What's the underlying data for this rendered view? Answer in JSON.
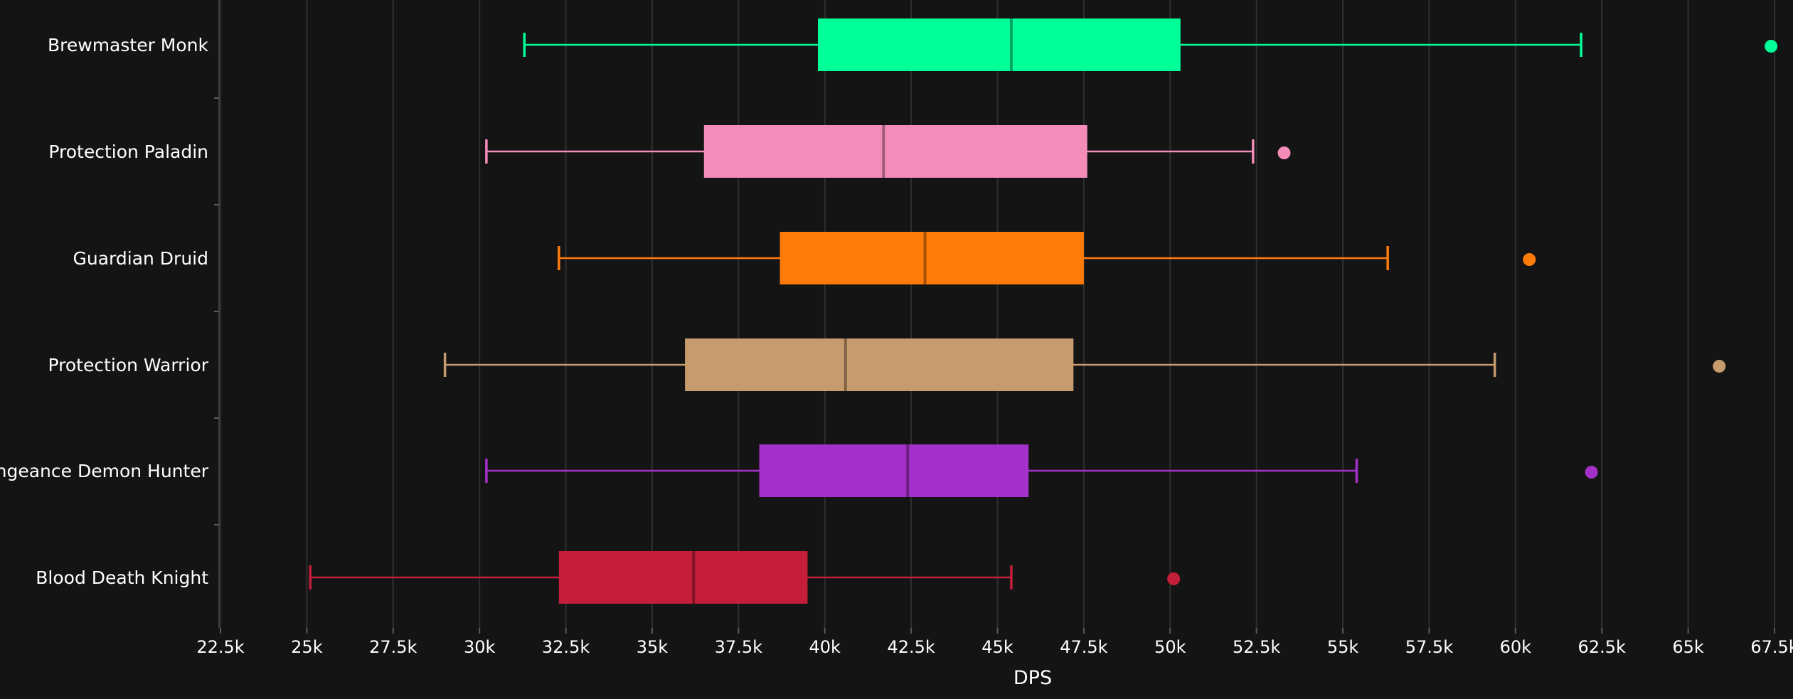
{
  "chart_data": {
    "type": "boxplot",
    "orientation": "horizontal",
    "xlabel": "DPS",
    "xlim": [
      22500,
      67500
    ],
    "x_ticks": [
      22500,
      25000,
      27500,
      30000,
      32500,
      35000,
      37500,
      40000,
      42500,
      45000,
      47500,
      50000,
      52500,
      55000,
      57500,
      60000,
      62500,
      65000,
      67500
    ],
    "x_tick_labels": [
      "22.5k",
      "25k",
      "27.5k",
      "30k",
      "32.5k",
      "35k",
      "37.5k",
      "40k",
      "42.5k",
      "45k",
      "47.5k",
      "50k",
      "52.5k",
      "55k",
      "57.5k",
      "60k",
      "62.5k",
      "65k",
      "67.5k"
    ],
    "grid": "vertical",
    "background_color": "#141414",
    "categories": [
      {
        "label": "Brewmaster Monk",
        "color": "#00ff98",
        "whisker_low": 31300,
        "q1": 39800,
        "median": 45400,
        "q3": 50300,
        "whisker_high": 61900,
        "outliers": [
          67400
        ]
      },
      {
        "label": "Protection Paladin",
        "color": "#f48cba",
        "whisker_low": 30200,
        "q1": 36500,
        "median": 41700,
        "q3": 47600,
        "whisker_high": 52400,
        "outliers": [
          53300
        ]
      },
      {
        "label": "Guardian Druid",
        "color": "#ff7c0a",
        "whisker_low": 32300,
        "q1": 38700,
        "median": 42900,
        "q3": 47500,
        "whisker_high": 56300,
        "outliers": [
          60400
        ]
      },
      {
        "label": "Protection Warrior",
        "color": "#c69b6d",
        "whisker_low": 29000,
        "q1": 35950,
        "median": 40600,
        "q3": 47200,
        "whisker_high": 59400,
        "outliers": [
          65900
        ]
      },
      {
        "label": "Vengeance Demon Hunter",
        "color": "#a330c9",
        "whisker_low": 30200,
        "q1": 38100,
        "median": 42400,
        "q3": 45900,
        "whisker_high": 55400,
        "outliers": [
          62200
        ]
      },
      {
        "label": "Blood Death Knight",
        "color": "#c41e3a",
        "whisker_low": 25100,
        "q1": 32300,
        "median": 36200,
        "q3": 39500,
        "whisker_high": 45400,
        "outliers": [
          50100
        ]
      }
    ]
  }
}
